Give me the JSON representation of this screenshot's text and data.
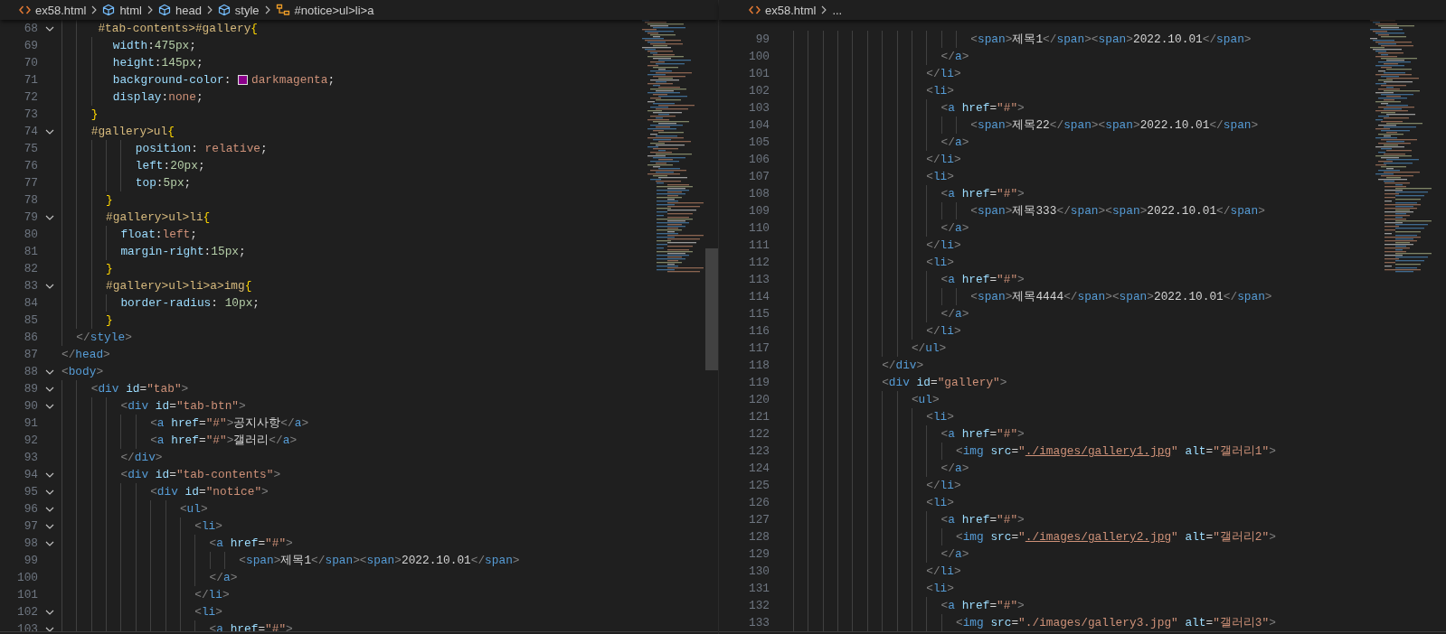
{
  "panes": [
    {
      "breadcrumbs": [
        {
          "label": "ex58.html",
          "kind": "file"
        },
        {
          "label": "html",
          "kind": "element"
        },
        {
          "label": "head",
          "kind": "element"
        },
        {
          "label": "style",
          "kind": "element"
        },
        {
          "label": "#notice>ul>li>a",
          "kind": "selector"
        }
      ],
      "sections": [
        {
          "kind": "css",
          "lines": [
            {
              "number": "68",
              "fold": true,
              "text": "     #tab-contents>#gallery{"
            },
            {
              "number": "69",
              "fold": false,
              "text": "       width:475px;"
            },
            {
              "number": "70",
              "fold": false,
              "text": "       height:145px;"
            },
            {
              "number": "71",
              "fold": false,
              "text": "       background-color: darkmagenta;",
              "color": "#8b008b"
            },
            {
              "number": "72",
              "fold": false,
              "text": "       display:none;"
            },
            {
              "number": "73",
              "fold": false,
              "text": "    }"
            },
            {
              "number": "74",
              "fold": true,
              "text": "    #gallery>ul{"
            },
            {
              "number": "75",
              "fold": false,
              "text": "          position: relative;"
            },
            {
              "number": "76",
              "fold": false,
              "text": "          left:20px;"
            },
            {
              "number": "77",
              "fold": false,
              "text": "          top:5px;"
            },
            {
              "number": "78",
              "fold": false,
              "text": "      }"
            },
            {
              "number": "79",
              "fold": true,
              "text": "      #gallery>ul>li{"
            },
            {
              "number": "80",
              "fold": false,
              "text": "        float:left;"
            },
            {
              "number": "81",
              "fold": false,
              "text": "        margin-right:15px;"
            },
            {
              "number": "82",
              "fold": false,
              "text": "      }"
            },
            {
              "number": "83",
              "fold": true,
              "text": "      #gallery>ul>li>a>img{"
            },
            {
              "number": "84",
              "fold": false,
              "text": "        border-radius: 10px;"
            },
            {
              "number": "85",
              "fold": false,
              "text": "      }"
            }
          ]
        },
        {
          "kind": "html",
          "lines": [
            {
              "number": "86",
              "fold": false,
              "text": "  </style>"
            },
            {
              "number": "87",
              "fold": false,
              "text": "</head>"
            },
            {
              "number": "88",
              "fold": true,
              "text": "<body>"
            },
            {
              "number": "89",
              "fold": true,
              "text": "    <div id=\"tab\">"
            },
            {
              "number": "90",
              "fold": true,
              "text": "        <div id=\"tab-btn\">"
            },
            {
              "number": "91",
              "fold": false,
              "text": "            <a href=\"#\">공지사항</a>"
            },
            {
              "number": "92",
              "fold": false,
              "text": "            <a href=\"#\">갤러리</a>"
            },
            {
              "number": "93",
              "fold": false,
              "text": "        </div>"
            },
            {
              "number": "94",
              "fold": true,
              "text": "        <div id=\"tab-contents\">"
            },
            {
              "number": "95",
              "fold": true,
              "text": "            <div id=\"notice\">"
            },
            {
              "number": "96",
              "fold": true,
              "text": "                <ul>"
            },
            {
              "number": "97",
              "fold": true,
              "text": "                  <li>"
            },
            {
              "number": "98",
              "fold": true,
              "text": "                    <a href=\"#\">"
            },
            {
              "number": "99",
              "fold": false,
              "text": "                        <span>제목1</span><span>2022.10.01</span>"
            },
            {
              "number": "100",
              "fold": false,
              "text": "                    </a>"
            },
            {
              "number": "101",
              "fold": false,
              "text": "                  </li>"
            },
            {
              "number": "102",
              "fold": true,
              "text": "                  <li>"
            },
            {
              "number": "103",
              "fold": true,
              "text": "                    <a href=\"#\">"
            }
          ]
        }
      ]
    },
    {
      "breadcrumbs": [
        {
          "label": "ex58.html",
          "kind": "file"
        },
        {
          "label": "...",
          "kind": "more"
        }
      ],
      "sections": [
        {
          "kind": "html",
          "lines": [
            {
              "number": "99",
              "text": "                        <span>제목1</span><span>2022.10.01</span>"
            },
            {
              "number": "100",
              "text": "                    </a>"
            },
            {
              "number": "101",
              "text": "                  </li>"
            },
            {
              "number": "102",
              "text": "                  <li>"
            },
            {
              "number": "103",
              "text": "                    <a href=\"#\">"
            },
            {
              "number": "104",
              "text": "                        <span>제목22</span><span>2022.10.01</span>"
            },
            {
              "number": "105",
              "text": "                    </a>"
            },
            {
              "number": "106",
              "text": "                  </li>"
            },
            {
              "number": "107",
              "text": "                  <li>"
            },
            {
              "number": "108",
              "text": "                    <a href=\"#\">"
            },
            {
              "number": "109",
              "text": "                        <span>제목333</span><span>2022.10.01</span>"
            },
            {
              "number": "110",
              "text": "                    </a>"
            },
            {
              "number": "111",
              "text": "                  </li>"
            },
            {
              "number": "112",
              "text": "                  <li>"
            },
            {
              "number": "113",
              "text": "                    <a href=\"#\">"
            },
            {
              "number": "114",
              "text": "                        <span>제목4444</span><span>2022.10.01</span>"
            },
            {
              "number": "115",
              "text": "                    </a>"
            },
            {
              "number": "116",
              "text": "                  </li>"
            },
            {
              "number": "117",
              "text": "                </ul>"
            },
            {
              "number": "118",
              "text": "            </div>"
            },
            {
              "number": "119",
              "text": "            <div id=\"gallery\">"
            },
            {
              "number": "120",
              "text": "                <ul>"
            },
            {
              "number": "121",
              "text": "                  <li>"
            },
            {
              "number": "122",
              "text": "                    <a href=\"#\">"
            },
            {
              "number": "123",
              "text": "                      <img src=\"./images/gallery1.jpg\" alt=\"갤러리1\">",
              "link": true
            },
            {
              "number": "124",
              "text": "                    </a>"
            },
            {
              "number": "125",
              "text": "                  </li>"
            },
            {
              "number": "126",
              "text": "                  <li>"
            },
            {
              "number": "127",
              "text": "                    <a href=\"#\">"
            },
            {
              "number": "128",
              "text": "                      <img src=\"./images/gallery2.jpg\" alt=\"갤러리2\">",
              "link": true
            },
            {
              "number": "129",
              "text": "                    </a>"
            },
            {
              "number": "130",
              "text": "                  </li>"
            },
            {
              "number": "131",
              "text": "                  <li>"
            },
            {
              "number": "132",
              "text": "                    <a href=\"#\">"
            },
            {
              "number": "133",
              "text": "                      <img src=\"./images/gallery3.jpg\" alt=\"갤러리3\">",
              "link": false
            }
          ]
        }
      ]
    }
  ]
}
